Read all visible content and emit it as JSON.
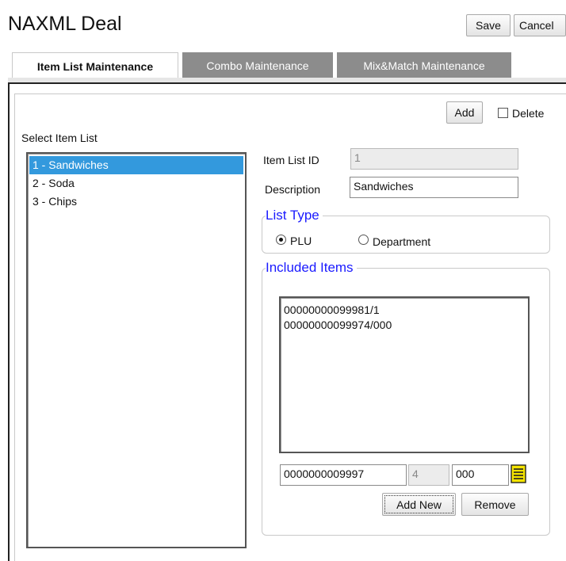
{
  "header": {
    "title": "NAXML Deal",
    "save_label": "Save",
    "cancel_label": "Cancel"
  },
  "tabs": [
    {
      "label": "Item List Maintenance",
      "active": true
    },
    {
      "label": "Combo Maintenance",
      "active": false
    },
    {
      "label": "Mix&Match Maintenance",
      "active": false
    }
  ],
  "toolbar": {
    "add_label": "Add",
    "delete_label": "Delete",
    "delete_checked": false
  },
  "select_list": {
    "label": "Select Item List",
    "items": [
      "1 - Sandwiches",
      "2 - Soda",
      "3 - Chips"
    ],
    "selected_index": 0
  },
  "form": {
    "item_list_id_label": "Item List ID",
    "item_list_id_value": "1",
    "description_label": "Description",
    "description_value": "Sandwiches"
  },
  "list_type": {
    "legend": "List Type",
    "options": [
      "PLU",
      "Department"
    ],
    "selected": "PLU"
  },
  "included_items": {
    "legend": "Included Items",
    "items": [
      "00000000099981/1",
      "00000000099974/000"
    ],
    "plu_input": "0000000009997",
    "check_digit": "4",
    "modifier_input": "000",
    "add_new_label": "Add New",
    "remove_label": "Remove"
  },
  "colors": {
    "selection": "#3399dd",
    "legend": "#1a1aff",
    "inactive_tab": "#8c8c8c"
  }
}
